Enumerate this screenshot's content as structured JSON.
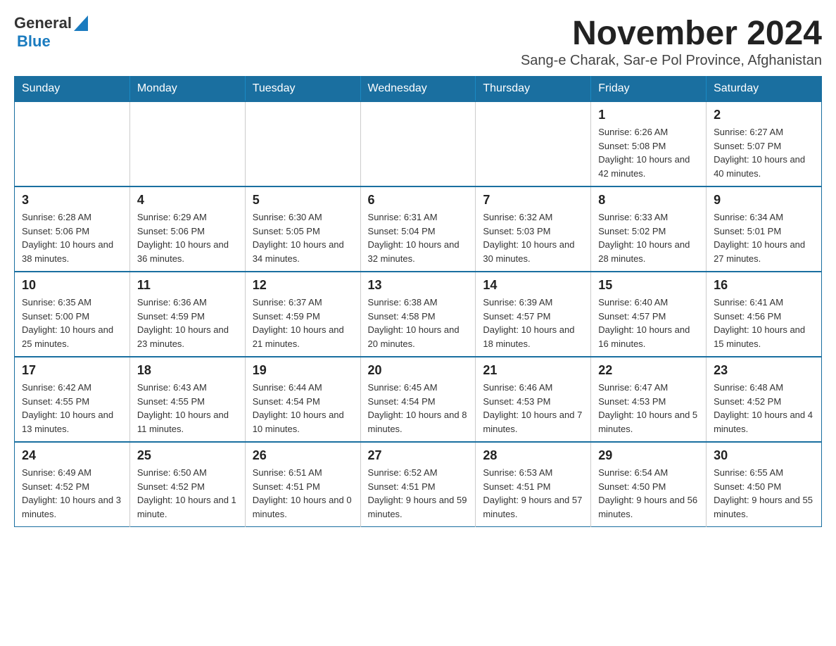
{
  "logo": {
    "general": "General",
    "blue": "Blue"
  },
  "title": "November 2024",
  "subtitle": "Sang-e Charak, Sar-e Pol Province, Afghanistan",
  "days_of_week": [
    "Sunday",
    "Monday",
    "Tuesday",
    "Wednesday",
    "Thursday",
    "Friday",
    "Saturday"
  ],
  "weeks": [
    [
      {
        "day": "",
        "info": ""
      },
      {
        "day": "",
        "info": ""
      },
      {
        "day": "",
        "info": ""
      },
      {
        "day": "",
        "info": ""
      },
      {
        "day": "",
        "info": ""
      },
      {
        "day": "1",
        "info": "Sunrise: 6:26 AM\nSunset: 5:08 PM\nDaylight: 10 hours and 42 minutes."
      },
      {
        "day": "2",
        "info": "Sunrise: 6:27 AM\nSunset: 5:07 PM\nDaylight: 10 hours and 40 minutes."
      }
    ],
    [
      {
        "day": "3",
        "info": "Sunrise: 6:28 AM\nSunset: 5:06 PM\nDaylight: 10 hours and 38 minutes."
      },
      {
        "day": "4",
        "info": "Sunrise: 6:29 AM\nSunset: 5:06 PM\nDaylight: 10 hours and 36 minutes."
      },
      {
        "day": "5",
        "info": "Sunrise: 6:30 AM\nSunset: 5:05 PM\nDaylight: 10 hours and 34 minutes."
      },
      {
        "day": "6",
        "info": "Sunrise: 6:31 AM\nSunset: 5:04 PM\nDaylight: 10 hours and 32 minutes."
      },
      {
        "day": "7",
        "info": "Sunrise: 6:32 AM\nSunset: 5:03 PM\nDaylight: 10 hours and 30 minutes."
      },
      {
        "day": "8",
        "info": "Sunrise: 6:33 AM\nSunset: 5:02 PM\nDaylight: 10 hours and 28 minutes."
      },
      {
        "day": "9",
        "info": "Sunrise: 6:34 AM\nSunset: 5:01 PM\nDaylight: 10 hours and 27 minutes."
      }
    ],
    [
      {
        "day": "10",
        "info": "Sunrise: 6:35 AM\nSunset: 5:00 PM\nDaylight: 10 hours and 25 minutes."
      },
      {
        "day": "11",
        "info": "Sunrise: 6:36 AM\nSunset: 4:59 PM\nDaylight: 10 hours and 23 minutes."
      },
      {
        "day": "12",
        "info": "Sunrise: 6:37 AM\nSunset: 4:59 PM\nDaylight: 10 hours and 21 minutes."
      },
      {
        "day": "13",
        "info": "Sunrise: 6:38 AM\nSunset: 4:58 PM\nDaylight: 10 hours and 20 minutes."
      },
      {
        "day": "14",
        "info": "Sunrise: 6:39 AM\nSunset: 4:57 PM\nDaylight: 10 hours and 18 minutes."
      },
      {
        "day": "15",
        "info": "Sunrise: 6:40 AM\nSunset: 4:57 PM\nDaylight: 10 hours and 16 minutes."
      },
      {
        "day": "16",
        "info": "Sunrise: 6:41 AM\nSunset: 4:56 PM\nDaylight: 10 hours and 15 minutes."
      }
    ],
    [
      {
        "day": "17",
        "info": "Sunrise: 6:42 AM\nSunset: 4:55 PM\nDaylight: 10 hours and 13 minutes."
      },
      {
        "day": "18",
        "info": "Sunrise: 6:43 AM\nSunset: 4:55 PM\nDaylight: 10 hours and 11 minutes."
      },
      {
        "day": "19",
        "info": "Sunrise: 6:44 AM\nSunset: 4:54 PM\nDaylight: 10 hours and 10 minutes."
      },
      {
        "day": "20",
        "info": "Sunrise: 6:45 AM\nSunset: 4:54 PM\nDaylight: 10 hours and 8 minutes."
      },
      {
        "day": "21",
        "info": "Sunrise: 6:46 AM\nSunset: 4:53 PM\nDaylight: 10 hours and 7 minutes."
      },
      {
        "day": "22",
        "info": "Sunrise: 6:47 AM\nSunset: 4:53 PM\nDaylight: 10 hours and 5 minutes."
      },
      {
        "day": "23",
        "info": "Sunrise: 6:48 AM\nSunset: 4:52 PM\nDaylight: 10 hours and 4 minutes."
      }
    ],
    [
      {
        "day": "24",
        "info": "Sunrise: 6:49 AM\nSunset: 4:52 PM\nDaylight: 10 hours and 3 minutes."
      },
      {
        "day": "25",
        "info": "Sunrise: 6:50 AM\nSunset: 4:52 PM\nDaylight: 10 hours and 1 minute."
      },
      {
        "day": "26",
        "info": "Sunrise: 6:51 AM\nSunset: 4:51 PM\nDaylight: 10 hours and 0 minutes."
      },
      {
        "day": "27",
        "info": "Sunrise: 6:52 AM\nSunset: 4:51 PM\nDaylight: 9 hours and 59 minutes."
      },
      {
        "day": "28",
        "info": "Sunrise: 6:53 AM\nSunset: 4:51 PM\nDaylight: 9 hours and 57 minutes."
      },
      {
        "day": "29",
        "info": "Sunrise: 6:54 AM\nSunset: 4:50 PM\nDaylight: 9 hours and 56 minutes."
      },
      {
        "day": "30",
        "info": "Sunrise: 6:55 AM\nSunset: 4:50 PM\nDaylight: 9 hours and 55 minutes."
      }
    ]
  ]
}
